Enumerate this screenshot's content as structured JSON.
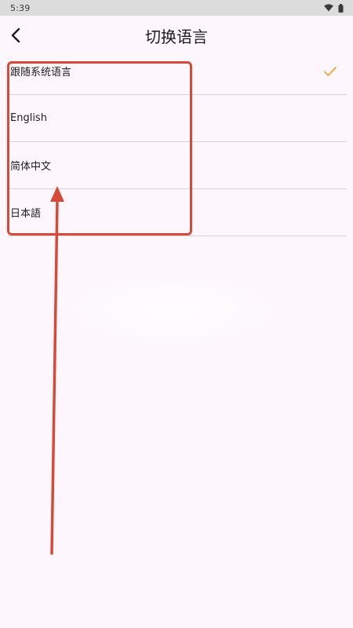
{
  "status_bar": {
    "time": "5:39",
    "icons": [
      "wifi-icon",
      "battery-icon"
    ]
  },
  "app_bar": {
    "title": "切换语言",
    "back_icon": "back-arrow-icon"
  },
  "language_list": {
    "items": [
      {
        "label": "跟随系统语言",
        "selected": true
      },
      {
        "label": "English",
        "selected": false
      },
      {
        "label": "简体中文",
        "selected": false
      },
      {
        "label": "日本語",
        "selected": false
      }
    ]
  },
  "colors": {
    "accent_check": "#f2a33a",
    "annotation": "#d84a38",
    "background": "#fdf7fd",
    "status_bar": "#dcdcdc"
  }
}
